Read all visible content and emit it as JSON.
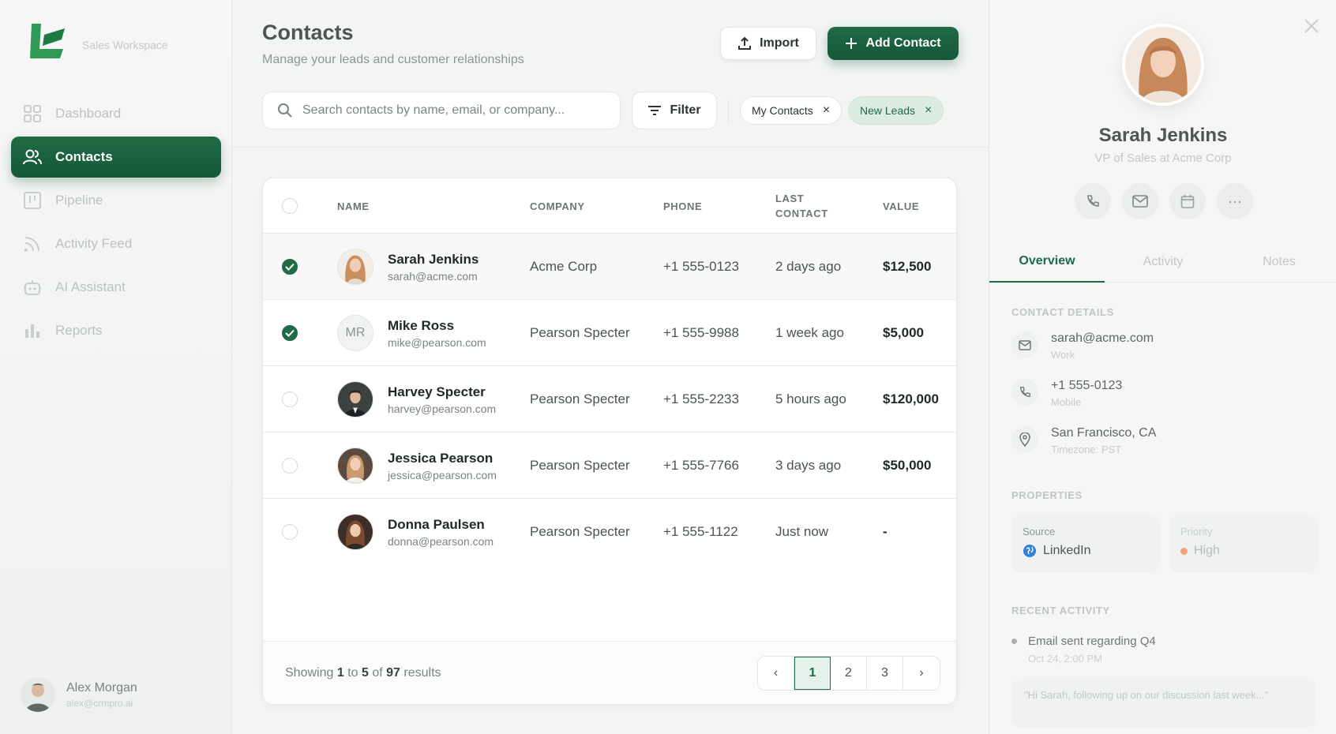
{
  "brand": {
    "workspace": "Sales Workspace"
  },
  "nav": [
    {
      "label": "Dashboard",
      "icon": "dashboard-icon",
      "active": false
    },
    {
      "label": "Contacts",
      "icon": "users-icon",
      "active": true
    },
    {
      "label": "Pipeline",
      "icon": "pipeline-icon",
      "active": false
    },
    {
      "label": "Activity Feed",
      "icon": "rss-icon",
      "active": false
    },
    {
      "label": "AI Assistant",
      "icon": "bot-icon",
      "active": false
    },
    {
      "label": "Reports",
      "icon": "bar-chart-icon",
      "active": false
    }
  ],
  "user": {
    "name": "Alex Morgan",
    "email": "alex@crmpro.ai"
  },
  "header": {
    "title": "Contacts",
    "subtitle": "Manage your leads and customer relationships",
    "import_label": "Import",
    "add_label": "Add Contact"
  },
  "search": {
    "placeholder": "Search contacts by name, email, or company..."
  },
  "filter_label": "Filter",
  "chips": [
    {
      "label": "My Contacts",
      "close": "×"
    },
    {
      "label": "New Leads",
      "close": "×"
    }
  ],
  "table": {
    "columns": {
      "name": "NAME",
      "company": "COMPANY",
      "phone": "PHONE",
      "last_contact_1": "LAST",
      "last_contact_2": "CONTACT",
      "value": "VALUE"
    },
    "rows": [
      {
        "name": "Sarah Jenkins",
        "email": "sarah@acme.com",
        "company": "Acme Corp",
        "phone": "+1 555-0123",
        "last": "2 days ago",
        "value": "$12,500",
        "selected": true,
        "initials": ""
      },
      {
        "name": "Mike Ross",
        "email": "mike@pearson.com",
        "company": "Pearson Specter",
        "phone": "+1 555-9988",
        "last": "1 week ago",
        "value": "$5,000",
        "selected": true,
        "initials": "MR"
      },
      {
        "name": "Harvey Specter",
        "email": "harvey@pearson.com",
        "company": "Pearson Specter",
        "phone": "+1 555-2233",
        "last": "5 hours ago",
        "value": "$120,000",
        "selected": false,
        "initials": ""
      },
      {
        "name": "Jessica Pearson",
        "email": "jessica@pearson.com",
        "company": "Pearson Specter",
        "phone": "+1 555-7766",
        "last": "3 days ago",
        "value": "$50,000",
        "selected": false,
        "initials": ""
      },
      {
        "name": "Donna Paulsen",
        "email": "donna@pearson.com",
        "company": "Pearson Specter",
        "phone": "+1 555-1122",
        "last": "Just now",
        "value": "-",
        "selected": false,
        "initials": ""
      }
    ]
  },
  "pagination": {
    "showing_prefix": "Showing",
    "from": "1",
    "to_word": "to",
    "to": "5",
    "of_word": "of",
    "total": "97",
    "results_word": "results",
    "pages": [
      "1",
      "2",
      "3"
    ],
    "current": "1",
    "prev": "‹",
    "next": "›"
  },
  "detail": {
    "name": "Sarah Jenkins",
    "role": "VP of Sales at Acme Corp",
    "more": "···",
    "tabs": [
      "Overview",
      "Activity",
      "Notes"
    ],
    "contact_details_heading": "CONTACT DETAILS",
    "email": "sarah@acme.com",
    "email_type": "Work",
    "phone": "+1 555-0123",
    "phone_type": "Mobile",
    "location": "San Francisco, CA",
    "timezone": "Timezone: PST",
    "properties_heading": "PROPERTIES",
    "source_label": "Source",
    "source_value": "LinkedIn",
    "priority_label": "Priority",
    "priority_value": "High",
    "recent_heading": "RECENT ACTIVITY",
    "activity_title": "Email sent regarding Q4",
    "activity_date": "Oct 24, 2:00 PM",
    "activity_quote": "\"Hi Sarah, following up on our discussion last week...\""
  },
  "colors": {
    "brand": "#1f6b45",
    "accent_light": "#dcece2",
    "priority_dot": "#f0a47a"
  }
}
